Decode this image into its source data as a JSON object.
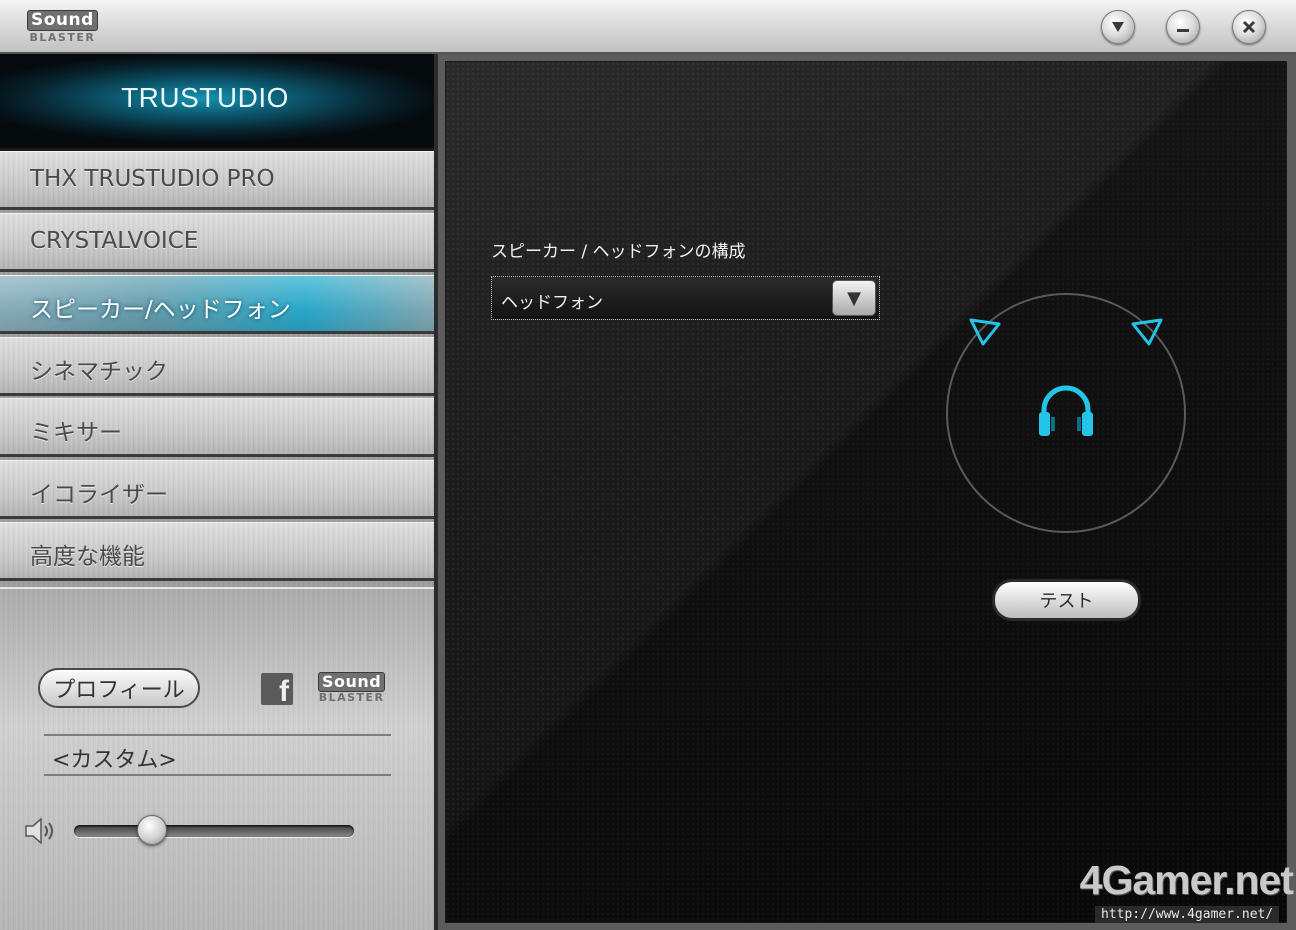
{
  "titlebar": {
    "logo_line1": "Sound",
    "logo_line2": "BLASTER",
    "buttons": {
      "dropdown_icon": "triangle-down-icon",
      "minimize_icon": "minimize-icon",
      "close_icon": "close-icon"
    }
  },
  "sidebar": {
    "header_title": "TRUSTUDIO",
    "nav_items": [
      {
        "label": "THX TRUSTUDIO PRO"
      },
      {
        "label": "CRYSTALVOICE"
      },
      {
        "label": "スピーカー/ヘッドフォン",
        "active": true
      },
      {
        "label": "シネマチック"
      },
      {
        "label": "ミキサー"
      },
      {
        "label": "イコライザー"
      },
      {
        "label": "高度な機能"
      }
    ],
    "profile_button_label": "プロフィール",
    "facebook_glyph": "f",
    "logo_line1": "Sound",
    "logo_line2": "BLASTER",
    "profile_name": "<カスタム>",
    "volume_level": 0.25
  },
  "main": {
    "config_label": "スピーカー / ヘッドフォンの構成",
    "config_select_value": "ヘッドフォン",
    "dropdown_arrow": "▼",
    "test_button_label": "テスト",
    "accent_color": "#23c4e8"
  },
  "watermark": {
    "logo": "4Gamer.net",
    "url": "http://www.4gamer.net/"
  }
}
